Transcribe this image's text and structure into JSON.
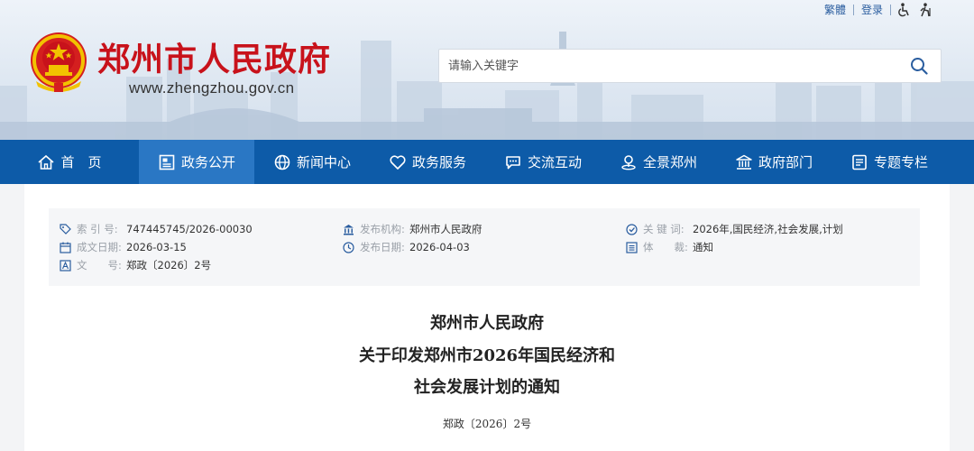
{
  "top_links": {
    "traditional": "繁體",
    "login": "登录"
  },
  "site": {
    "title": "郑州市人民政府",
    "url": "www.zhengzhou.gov.cn"
  },
  "search": {
    "placeholder": "请输入关键字",
    "value": ""
  },
  "nav": {
    "items": [
      {
        "label": "首　页",
        "icon": "home-icon"
      },
      {
        "label": "政务公开",
        "icon": "news-board-icon",
        "active": true
      },
      {
        "label": "新闻中心",
        "icon": "globe-icon"
      },
      {
        "label": "政务服务",
        "icon": "heart-icon"
      },
      {
        "label": "交流互动",
        "icon": "chat-icon"
      },
      {
        "label": "全景郑州",
        "icon": "panorama-icon"
      },
      {
        "label": "政府部门",
        "icon": "institution-icon"
      },
      {
        "label": "专题专栏",
        "icon": "column-icon"
      }
    ]
  },
  "meta": {
    "index_label": "索  引  号:",
    "index_value": "747445745/2026-00030",
    "issuer_label": "发布机构:",
    "issuer_value": "郑州市人民政府",
    "keywords_label": "关  键  词:",
    "keywords_value": "2026年,国民经济,社会发展,计划",
    "created_label": "成文日期:",
    "created_value": "2026-03-15",
    "published_label": "发布日期:",
    "published_value": "2026-04-03",
    "genre_label": "体　　裁:",
    "genre_value": "通知",
    "docno_label": "文　　号:",
    "docno_value": "郑政〔2026〕2号"
  },
  "document": {
    "title_line1": "郑州市人民政府",
    "title_line2": "关于印发郑州市2026年国民经济和",
    "title_line3": "社会发展计划的通知",
    "number": "郑政〔2026〕2号"
  },
  "colors": {
    "brand_red": "#c8121b",
    "nav_blue": "#0d5ba8",
    "nav_active": "#2a77c4"
  }
}
